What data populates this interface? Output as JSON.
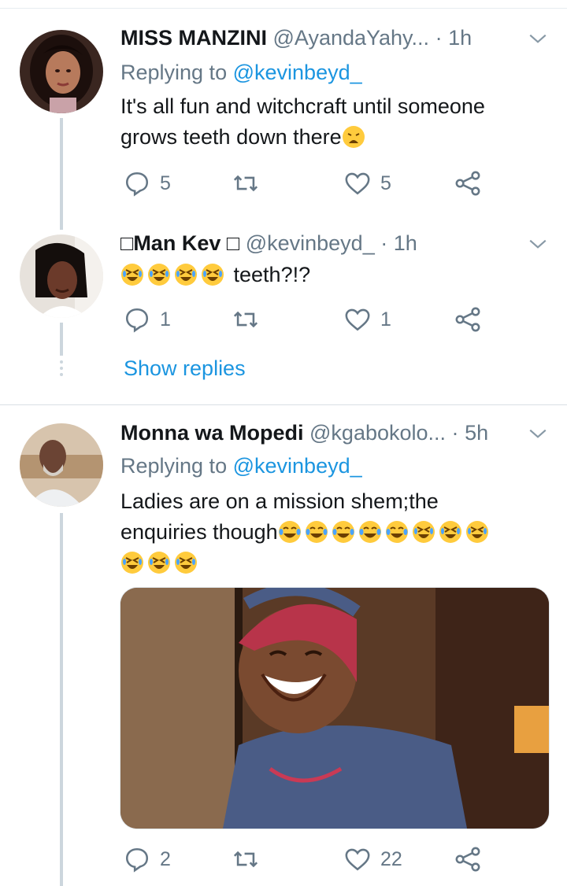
{
  "tweets": [
    {
      "name": "MISS MANZINI",
      "handle": "@AyandaYahy...",
      "sep": "·",
      "time": "1h",
      "replying_label": "Replying to",
      "replying_to": "@kevinbeyd_",
      "text_line1": "It's all fun and witchcraft until someone",
      "text_line2": "grows teeth down there",
      "trailing_emoji": "weary-face-emoji",
      "reply_count": "5",
      "like_count": "5"
    },
    {
      "name": "Man Kev",
      "name_prefix": "□",
      "name_suffix": "□",
      "handle": "@kevinbeyd_",
      "sep": "·",
      "time": "1h",
      "emojis": [
        "rolling-laugh-emoji",
        "rolling-laugh-emoji",
        "rolling-laugh-emoji",
        "rolling-laugh-emoji"
      ],
      "text": "teeth?!?",
      "reply_count": "1",
      "like_count": "1",
      "show_replies": "Show replies"
    },
    {
      "name": "Monna wa Mopedi",
      "handle": "@kgabokolo...",
      "sep": "·",
      "time": "5h",
      "replying_label": "Replying to",
      "replying_to": "@kevinbeyd_",
      "text_line1": "Ladies are on a mission shem;the",
      "text_line2": "enquiries though",
      "reply_count": "2",
      "like_count": "22"
    }
  ],
  "colors": {
    "link": "#1b95e0",
    "secondary": "#657786",
    "thread_line": "#ccd6dd"
  }
}
